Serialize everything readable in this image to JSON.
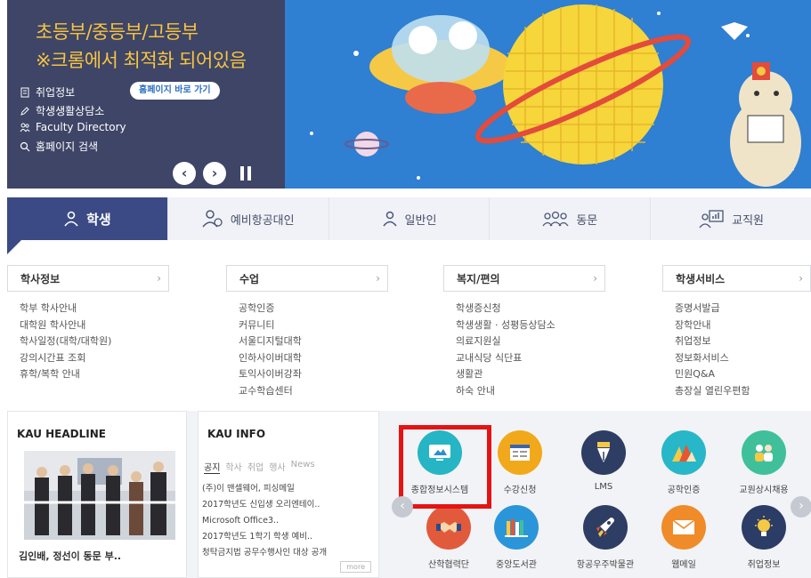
{
  "hero": {
    "line1": "초등부/중등부/고등부",
    "line2": "※크롬에서 최적화 되어있음",
    "quick_links": [
      "취업정보",
      "학생생활상담소",
      "Faculty Directory",
      "홈페이지 검색"
    ],
    "homepage_button": "홈페이지 바로 가기",
    "prev_label": "‹",
    "next_label": "›",
    "colors": {
      "left_bg": "#3e4566",
      "headline": "#f6c443",
      "right_bg": "#2f7fd2"
    }
  },
  "tabs": [
    {
      "label": "학생",
      "icon": "student-icon",
      "active": true
    },
    {
      "label": "예비항공대인",
      "icon": "prospective-student-icon",
      "active": false
    },
    {
      "label": "일반인",
      "icon": "person-icon",
      "active": false
    },
    {
      "label": "동문",
      "icon": "alumni-icon",
      "active": false
    },
    {
      "label": "교직원",
      "icon": "staff-icon",
      "active": false
    }
  ],
  "columns": [
    {
      "title": "학사정보",
      "items": [
        "학부 학사안내",
        "대학원 학사안내",
        "학사일정(대학/대학원)",
        "강의시간표 조회",
        "휴학/복학 안내"
      ]
    },
    {
      "title": "수업",
      "items": [
        "공학인증",
        "커뮤니티",
        "서울디지털대학",
        "인하사이버대학",
        "토익사이버강좌",
        "교수학습센터"
      ]
    },
    {
      "title": "복지/편의",
      "items": [
        "학생증신청",
        "학생생활 · 성평등상담소",
        "의료지원실",
        "교내식당 식단표",
        "생활관",
        "하숙 안내"
      ]
    },
    {
      "title": "학생서비스",
      "items": [
        "증명서발급",
        "장학안내",
        "취업정보",
        "정보화서비스",
        "민원Q&A",
        "총장실 열린우편함"
      ]
    }
  ],
  "headline": {
    "title": "KAU HEADLINE",
    "caption": "김인배, 정선이 동문 부.."
  },
  "info": {
    "title": "KAU INFO",
    "tabs": [
      "공지",
      "학사",
      "취업",
      "행사",
      "News"
    ],
    "items": [
      "(주)이 맨셀웨어, 피싱메일",
      "2017학년도 신입생 오리엔테이..",
      "Microsoft Office3..",
      "2017학년도 1학기 학생 예비..",
      "청탁금지법 공무수행사인 대상 공개"
    ],
    "more": "more"
  },
  "services": [
    {
      "label": "종합정보시스템",
      "icon": "monitor-icon",
      "color": "#26b5c4"
    },
    {
      "label": "수강신청",
      "icon": "course-registration-icon",
      "color": "#f2a81b"
    },
    {
      "label": "LMS",
      "icon": "pen-nib-icon",
      "color": "#2e3d63"
    },
    {
      "label": "공학인증",
      "icon": "mountain-icon",
      "color": "#27b7c8"
    },
    {
      "label": "교원상시채용",
      "icon": "people-icon",
      "color": "#3fc09b"
    },
    {
      "label": "산학협력단",
      "icon": "handshake-icon",
      "color": "#e25a3c"
    },
    {
      "label": "중앙도서관",
      "icon": "library-books-icon",
      "color": "#2a96d9"
    },
    {
      "label": "항공우주박물관",
      "icon": "rocket-icon",
      "color": "#2e3d63"
    },
    {
      "label": "웹메일",
      "icon": "mail-icon",
      "color": "#f08b2a"
    },
    {
      "label": "취업정보",
      "icon": "lightbulb-icon",
      "color": "#2b3c66"
    }
  ]
}
